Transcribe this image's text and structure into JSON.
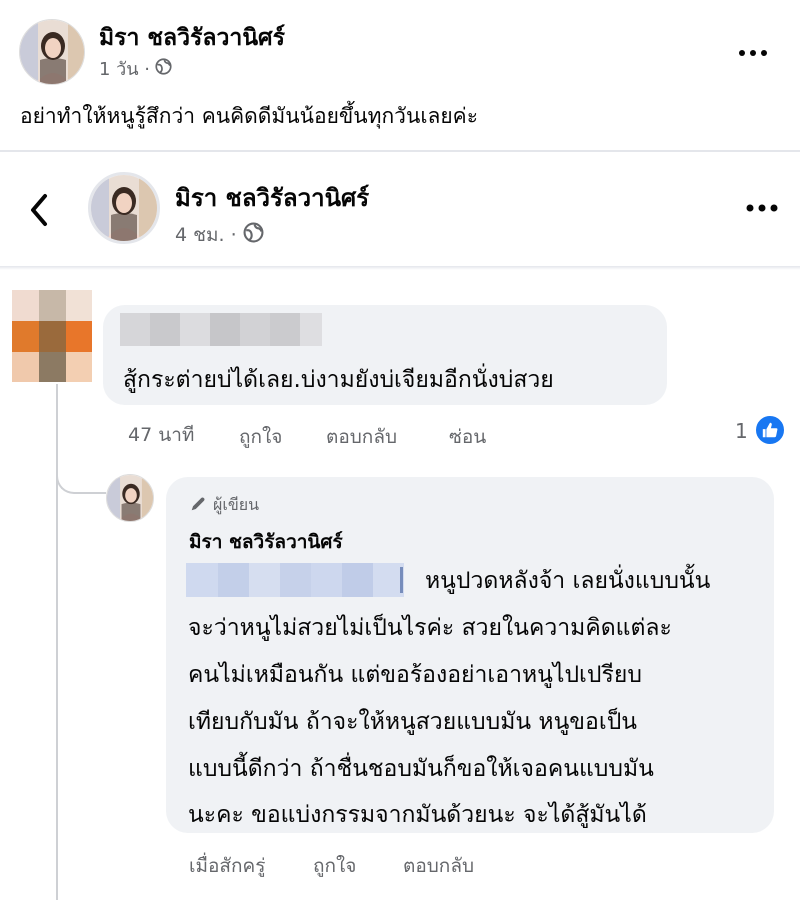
{
  "post": {
    "author": "มิรา ชลวิรัลวานิศร์",
    "time": "1 วัน ·",
    "text": "อย่าทำให้หนูรู้สึกว่า คนคิดดีมันน้อยขึ้นทุกวันเลยค่ะ",
    "more_icon": "more-horizontal-icon",
    "privacy_icon": "globe-icon"
  },
  "comment_header": {
    "author": "มิรา ชลวิรัลวานิศร์",
    "time": "4 ชม. ·",
    "back_icon": "chevron-left-icon",
    "more_icon": "more-horizontal-icon",
    "privacy_icon": "globe-icon"
  },
  "comment": {
    "text": "สู้กระต่ายบ่ได้เลย.บ่งามยังบ่เจียมอีกนั่งบ่สวย",
    "time": "47 นาที",
    "like_label": "ถูกใจ",
    "reply_label": "ตอบกลับ",
    "hide_label": "ซ่อน",
    "reaction_count": "1",
    "reaction_icon": "thumbs-up-icon"
  },
  "reply": {
    "badge": "ผู้เขียน",
    "author": "มิรา ชลวิรัลวานิศร์",
    "lines": [
      "หนูปวดหลังจ้า เลยนั่งแบบนั้น",
      "จะว่าหนูไม่สวยไม่เป็นไรค่ะ สวยในความคิดแต่ละ",
      "คนไม่เหมือนกัน แต่ขอร้องอย่าเอาหนูไปเปรียบ",
      "เทียบกับมัน ถ้าจะให้หนูสวยแบบมัน หนูขอเป็น",
      "แบบนี้ดีกว่า ถ้าชื่นชอบมันก็ขอให้เจอคนแบบมัน",
      "นะคะ ขอแบ่งกรรมจากมันด้วยนะ จะได้สู้มันได้"
    ],
    "time": "เมื่อสักครู่",
    "like_label": "ถูกใจ",
    "reply_label": "ตอบกลับ",
    "badge_icon": "pen-icon"
  },
  "colors": {
    "bubble": "#f0f2f5",
    "secondary_text": "#65676b",
    "like_blue": "#1877f2"
  }
}
